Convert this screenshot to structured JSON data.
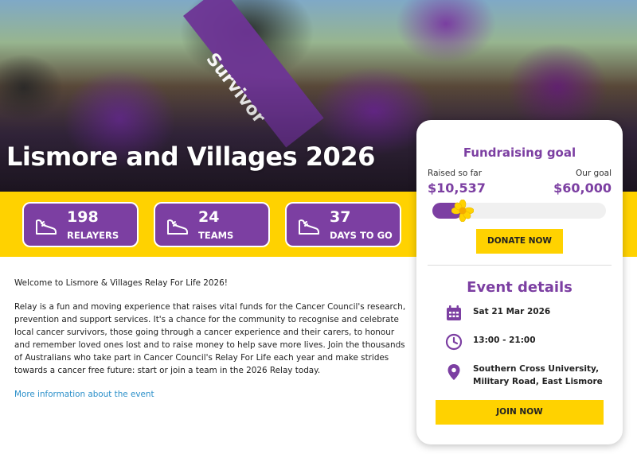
{
  "hero": {
    "title": "Lismore and Villages 2026",
    "sash_text": "Survivor"
  },
  "stats": [
    {
      "value": "198",
      "label": "RELAYERS",
      "icon": "shoe-icon"
    },
    {
      "value": "24",
      "label": "TEAMS",
      "icon": "shoe-icon"
    },
    {
      "value": "37",
      "label": "DAYS TO GO",
      "icon": "shoe-icon"
    }
  ],
  "content": {
    "welcome": "Welcome to Lismore & Villages Relay For Life 2026!",
    "body": "Relay is a fun and moving experience that raises vital funds for the Cancer Council's research, prevention and support services. It's a chance for the community to recognise and celebrate local cancer survivors, those going through a cancer experience and their carers, to honour and remember loved ones lost and to raise money to help save more lives. Join the thousands of Australians who take part in Cancer Council's Relay For Life each year and make strides towards a cancer free future: start or join a team in the 2026 Relay today.",
    "link": "More information about the event"
  },
  "fundraising": {
    "title": "Fundraising goal",
    "raised_label": "Raised so far",
    "raised_value": "$10,537",
    "goal_label": "Our goal",
    "goal_value": "$60,000",
    "progress_fraction": 0.176,
    "donate_label": "DONATE NOW"
  },
  "event": {
    "title": "Event details",
    "date": "Sat 21 Mar 2026",
    "time": "13:00 - 21:00",
    "location_line1": "Southern Cross University,",
    "location_line2": "Military Road, East Lismore",
    "join_label": "JOIN NOW"
  },
  "colors": {
    "brand_purple": "#7c3fa2",
    "brand_yellow": "#ffd200",
    "link_blue": "#2a8fc9"
  }
}
